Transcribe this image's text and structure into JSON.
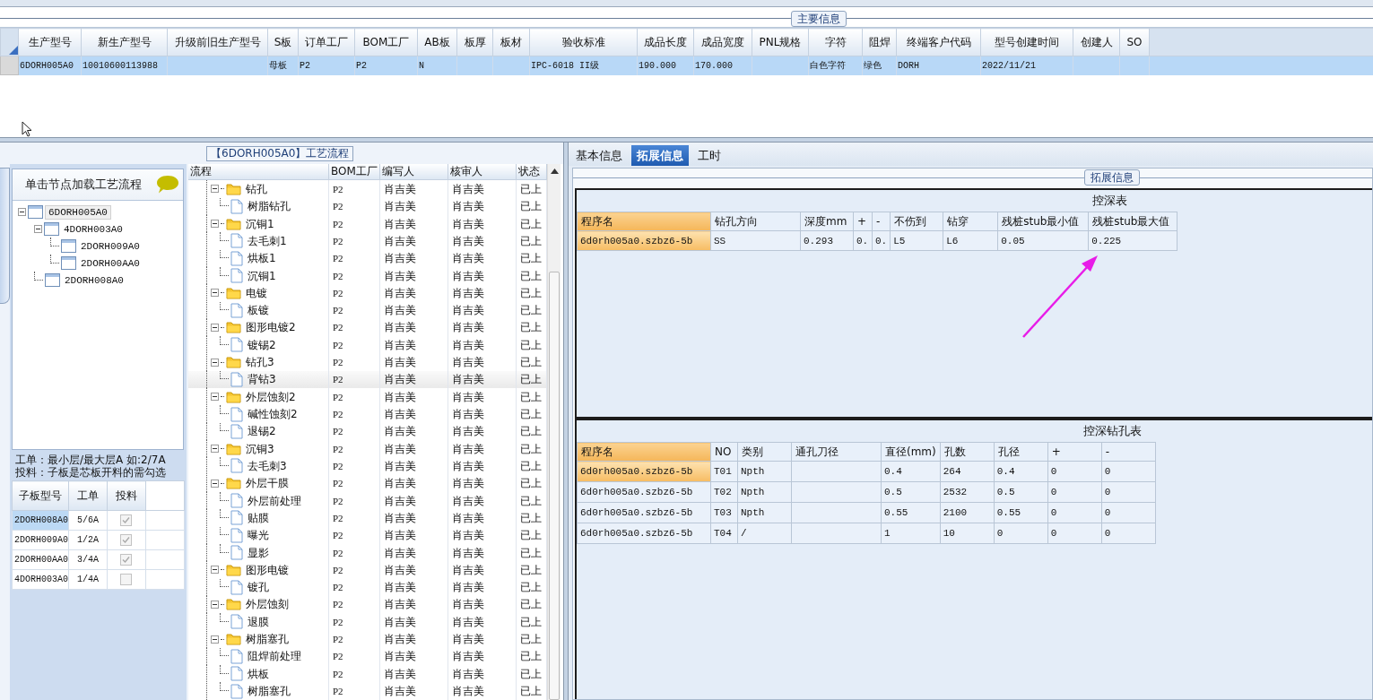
{
  "main_info": {
    "title": "主要信息",
    "columns": [
      "生产型号",
      "新生产型号",
      "升级前旧生产型号",
      "S板",
      "订单工厂",
      "BOM工厂",
      "AB板",
      "板厚",
      "板材",
      "验收标准",
      "成品长度",
      "成品宽度",
      "PNL规格",
      "字符",
      "阻焊",
      "终端客户代码",
      "型号创建时间",
      "创建人",
      "SO"
    ],
    "rows": [
      {
        "selected": true,
        "cells": [
          "6DORH005A0",
          "10010600113988",
          "",
          "母板",
          "P2",
          "P2",
          "N",
          "",
          "",
          "IPC-6018 II级",
          "190.000",
          "170.000",
          "",
          "白色字符",
          "绿色",
          "DORH",
          "2022/11/21",
          "",
          ""
        ]
      }
    ]
  },
  "process_panel": {
    "title": "【6DORH005A0】工艺流程"
  },
  "board_tree": {
    "hint": "单击节点加载工艺流程",
    "nodes": [
      {
        "label": "6DORH005A0",
        "selected": true,
        "expanded": true,
        "children": [
          {
            "label": "4DORH003A0",
            "selected": false,
            "expanded": true,
            "children": [
              {
                "label": "2DORH009A0",
                "selected": false
              },
              {
                "label": "2DORH00AA0",
                "selected": false
              }
            ]
          },
          {
            "label": "2DORH008A0",
            "selected": false
          }
        ]
      }
    ]
  },
  "notes": [
    "工单：最小层/最大层A 如:2/7A",
    "投料：子板是芯板开料的需勾选"
  ],
  "sub_boards": {
    "columns": [
      "子板型号",
      "工单",
      "投料"
    ],
    "rows": [
      {
        "model": "2DORH008A0",
        "order": "5/6A",
        "checked": true,
        "selected": true
      },
      {
        "model": "2DORH009A0",
        "order": "1/2A",
        "checked": true,
        "selected": false
      },
      {
        "model": "2DORH00AA0",
        "order": "3/4A",
        "checked": true,
        "selected": false
      },
      {
        "model": "4DORH003A0",
        "order": "1/4A",
        "checked": false,
        "selected": false
      }
    ]
  },
  "flow": {
    "columns": [
      "流程",
      "BOM工厂",
      "编写人",
      "核审人",
      "状态"
    ],
    "steps": [
      {
        "name": "钻孔",
        "bom": "P2",
        "writer": "肖吉美",
        "reviewer": "肖吉美",
        "status": "已上",
        "selected": false,
        "expanded": true,
        "children": [
          {
            "name": "树脂钻孔",
            "bom": "P2",
            "writer": "肖吉美",
            "reviewer": "肖吉美",
            "status": "已上",
            "selected": false
          }
        ]
      },
      {
        "name": "沉铜1",
        "bom": "P2",
        "writer": "肖吉美",
        "reviewer": "肖吉美",
        "status": "已上",
        "selected": false,
        "expanded": true,
        "children": [
          {
            "name": "去毛刺1",
            "bom": "P2",
            "writer": "肖吉美",
            "reviewer": "肖吉美",
            "status": "已上",
            "selected": false
          },
          {
            "name": "烘板1",
            "bom": "P2",
            "writer": "肖吉美",
            "reviewer": "肖吉美",
            "status": "已上",
            "selected": false
          },
          {
            "name": "沉铜1",
            "bom": "P2",
            "writer": "肖吉美",
            "reviewer": "肖吉美",
            "status": "已上",
            "selected": false
          }
        ]
      },
      {
        "name": "电镀",
        "bom": "P2",
        "writer": "肖吉美",
        "reviewer": "肖吉美",
        "status": "已上",
        "selected": false,
        "expanded": true,
        "children": [
          {
            "name": "板镀",
            "bom": "P2",
            "writer": "肖吉美",
            "reviewer": "肖吉美",
            "status": "已上",
            "selected": false
          }
        ]
      },
      {
        "name": "图形电镀2",
        "bom": "P2",
        "writer": "肖吉美",
        "reviewer": "肖吉美",
        "status": "已上",
        "selected": false,
        "expanded": true,
        "children": [
          {
            "name": "镀锡2",
            "bom": "P2",
            "writer": "肖吉美",
            "reviewer": "肖吉美",
            "status": "已上",
            "selected": false
          }
        ]
      },
      {
        "name": "钻孔3",
        "bom": "P2",
        "writer": "肖吉美",
        "reviewer": "肖吉美",
        "status": "已上",
        "selected": false,
        "expanded": true,
        "children": [
          {
            "name": "背钻3",
            "bom": "P2",
            "writer": "肖吉美",
            "reviewer": "肖吉美",
            "status": "已上",
            "selected": true
          }
        ]
      },
      {
        "name": "外层蚀刻2",
        "bom": "P2",
        "writer": "肖吉美",
        "reviewer": "肖吉美",
        "status": "已上",
        "selected": false,
        "expanded": true,
        "children": [
          {
            "name": "碱性蚀刻2",
            "bom": "P2",
            "writer": "肖吉美",
            "reviewer": "肖吉美",
            "status": "已上",
            "selected": false
          },
          {
            "name": "退锡2",
            "bom": "P2",
            "writer": "肖吉美",
            "reviewer": "肖吉美",
            "status": "已上",
            "selected": false
          }
        ]
      },
      {
        "name": "沉铜3",
        "bom": "P2",
        "writer": "肖吉美",
        "reviewer": "肖吉美",
        "status": "已上",
        "selected": false,
        "expanded": true,
        "children": [
          {
            "name": "去毛刺3",
            "bom": "P2",
            "writer": "肖吉美",
            "reviewer": "肖吉美",
            "status": "已上",
            "selected": false
          }
        ]
      },
      {
        "name": "外层干膜",
        "bom": "P2",
        "writer": "肖吉美",
        "reviewer": "肖吉美",
        "status": "已上",
        "selected": false,
        "expanded": true,
        "children": [
          {
            "name": "外层前处理",
            "bom": "P2",
            "writer": "肖吉美",
            "reviewer": "肖吉美",
            "status": "已上",
            "selected": false
          },
          {
            "name": "贴膜",
            "bom": "P2",
            "writer": "肖吉美",
            "reviewer": "肖吉美",
            "status": "已上",
            "selected": false
          },
          {
            "name": "曝光",
            "bom": "P2",
            "writer": "肖吉美",
            "reviewer": "肖吉美",
            "status": "已上",
            "selected": false
          },
          {
            "name": "显影",
            "bom": "P2",
            "writer": "肖吉美",
            "reviewer": "肖吉美",
            "status": "已上",
            "selected": false
          }
        ]
      },
      {
        "name": "图形电镀",
        "bom": "P2",
        "writer": "肖吉美",
        "reviewer": "肖吉美",
        "status": "已上",
        "selected": false,
        "expanded": true,
        "children": [
          {
            "name": "镀孔",
            "bom": "P2",
            "writer": "肖吉美",
            "reviewer": "肖吉美",
            "status": "已上",
            "selected": false
          }
        ]
      },
      {
        "name": "外层蚀刻",
        "bom": "P2",
        "writer": "肖吉美",
        "reviewer": "肖吉美",
        "status": "已上",
        "selected": false,
        "expanded": true,
        "children": [
          {
            "name": "退膜",
            "bom": "P2",
            "writer": "肖吉美",
            "reviewer": "肖吉美",
            "status": "已上",
            "selected": false
          }
        ]
      },
      {
        "name": "树脂塞孔",
        "bom": "P2",
        "writer": "肖吉美",
        "reviewer": "肖吉美",
        "status": "已上",
        "selected": false,
        "expanded": true,
        "children": [
          {
            "name": "阻焊前处理",
            "bom": "P2",
            "writer": "肖吉美",
            "reviewer": "肖吉美",
            "status": "已上",
            "selected": false
          },
          {
            "name": "烘板",
            "bom": "P2",
            "writer": "肖吉美",
            "reviewer": "肖吉美",
            "status": "已上",
            "selected": false
          },
          {
            "name": "树脂塞孔",
            "bom": "P2",
            "writer": "肖吉美",
            "reviewer": "肖吉美",
            "status": "已上",
            "selected": false
          }
        ]
      }
    ]
  },
  "detail": {
    "tabs": [
      {
        "label": "基本信息",
        "selected": false
      },
      {
        "label": "拓展信息",
        "selected": true
      },
      {
        "label": "工时",
        "selected": false
      }
    ],
    "group_title": "拓展信息",
    "depth_table": {
      "title": "控深表",
      "columns": [
        "程序名",
        "钻孔方向",
        "深度mm",
        "+",
        "-",
        "不伤到",
        "钻穿",
        "残桩stub最小值",
        "残桩stub最大值"
      ],
      "rows": [
        {
          "selected": true,
          "cells": [
            "6d0rh005a0.szbz6-5b",
            "SS",
            "0.293",
            "0.",
            "0.",
            "L5",
            "L6",
            "0.05",
            "0.225"
          ]
        }
      ]
    },
    "hole_table": {
      "title": "控深钻孔表",
      "columns": [
        "程序名",
        "NO",
        "类别",
        "通孔刀径",
        "直径(mm)",
        "孔数",
        "孔径",
        "+",
        "-"
      ],
      "rows": [
        {
          "selected": true,
          "cells": [
            "6d0rh005a0.szbz6-5b",
            "T01",
            "Npth",
            "",
            "0.4",
            "264",
            "0.4",
            "0",
            "0"
          ]
        },
        {
          "selected": false,
          "cells": [
            "6d0rh005a0.szbz6-5b",
            "T02",
            "Npth",
            "",
            "0.5",
            "2532",
            "0.5",
            "0",
            "0"
          ]
        },
        {
          "selected": false,
          "cells": [
            "6d0rh005a0.szbz6-5b",
            "T03",
            "Npth",
            "",
            "0.55",
            "2100",
            "0.55",
            "0",
            "0"
          ]
        },
        {
          "selected": false,
          "cells": [
            "6d0rh005a0.szbz6-5b",
            "T04",
            "/",
            "",
            "1",
            "10",
            "0",
            "0",
            "0"
          ]
        }
      ]
    }
  }
}
